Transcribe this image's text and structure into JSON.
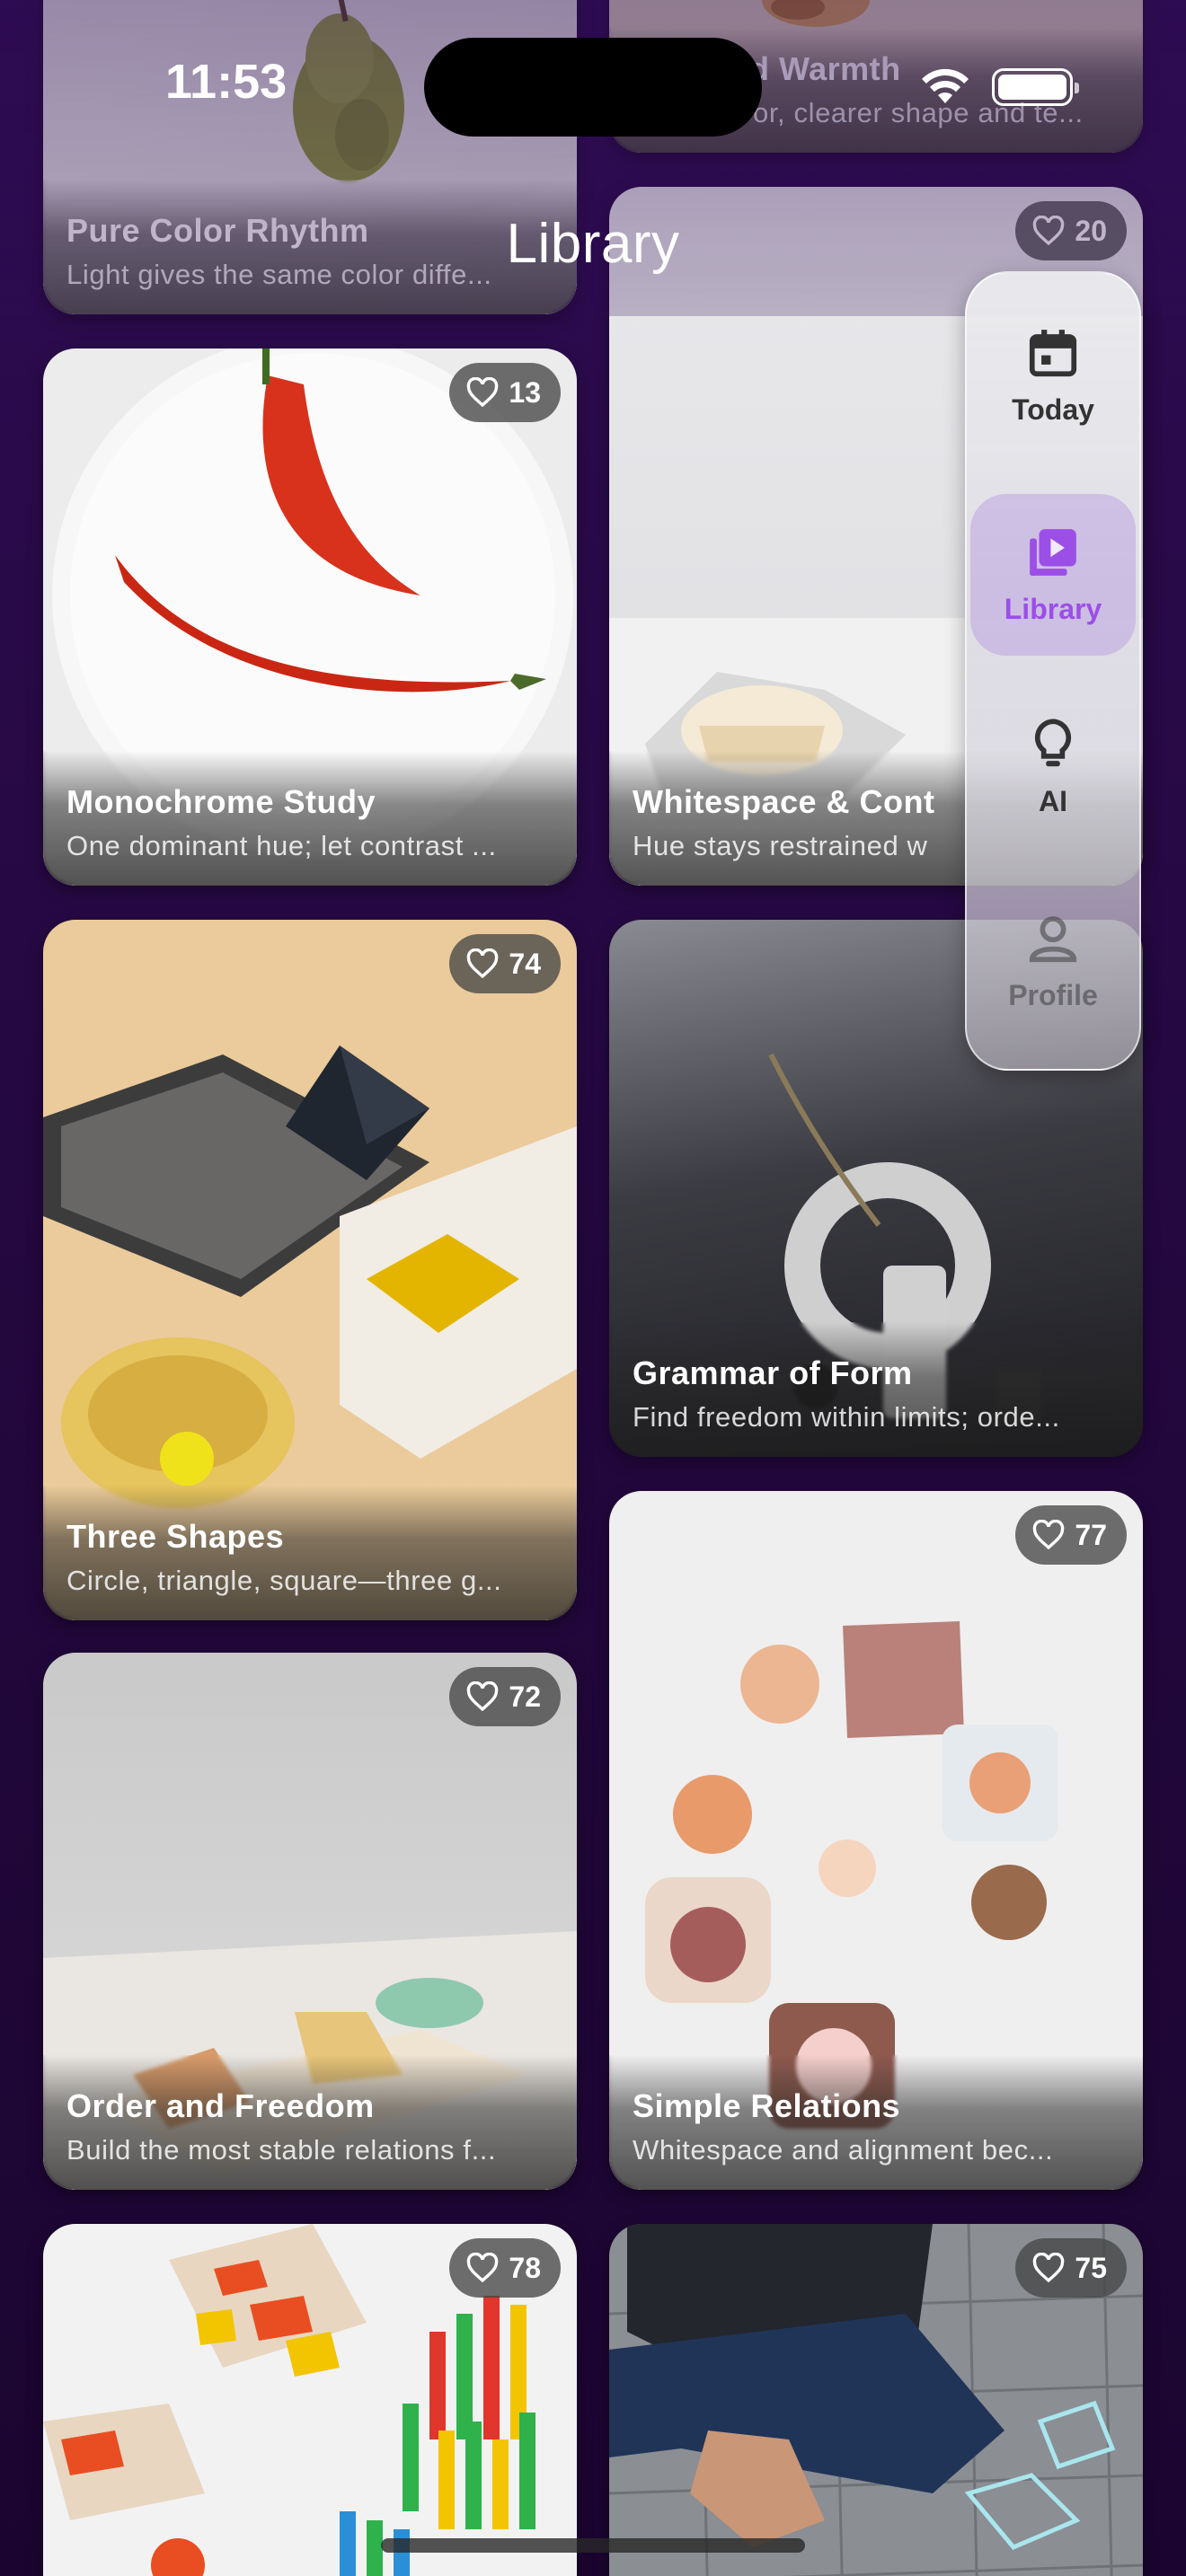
{
  "status_bar": {
    "time": "11:53"
  },
  "header": {
    "title": "Library"
  },
  "nav": {
    "items": [
      {
        "label": "Today",
        "icon": "calendar-icon",
        "active": false
      },
      {
        "label": "Library",
        "icon": "play-library-icon",
        "active": true
      },
      {
        "label": "AI",
        "icon": "lightbulb-icon",
        "active": false
      },
      {
        "label": "Profile",
        "icon": "person-icon",
        "active": false
      }
    ],
    "accent_color": "#9b4fe6"
  },
  "cards": [
    {
      "title": "Pure Color Rhythm",
      "subtitle": "Light gives the same color diffe...",
      "likes": ""
    },
    {
      "title": "d Warmth",
      "subtitle": "or, clearer shape and te...",
      "likes": ""
    },
    {
      "title": "Monochrome Study",
      "subtitle": "One dominant hue; let contrast ...",
      "likes": "13"
    },
    {
      "title": "Whitespace & Cont",
      "subtitle": "Hue stays restrained w",
      "likes": "20"
    },
    {
      "title": "Three Shapes",
      "subtitle": "Circle, triangle, square—three g...",
      "likes": "74"
    },
    {
      "title": "Grammar of Form",
      "subtitle": "Find freedom within limits; orde...",
      "likes": ""
    },
    {
      "title": "Order and Freedom",
      "subtitle": "Build the most stable relations f...",
      "likes": "72"
    },
    {
      "title": "Simple Relations",
      "subtitle": "Whitespace and alignment bec...",
      "likes": "77"
    },
    {
      "title": "",
      "subtitle": "",
      "likes": "78"
    },
    {
      "title": "",
      "subtitle": "",
      "likes": "75"
    }
  ]
}
